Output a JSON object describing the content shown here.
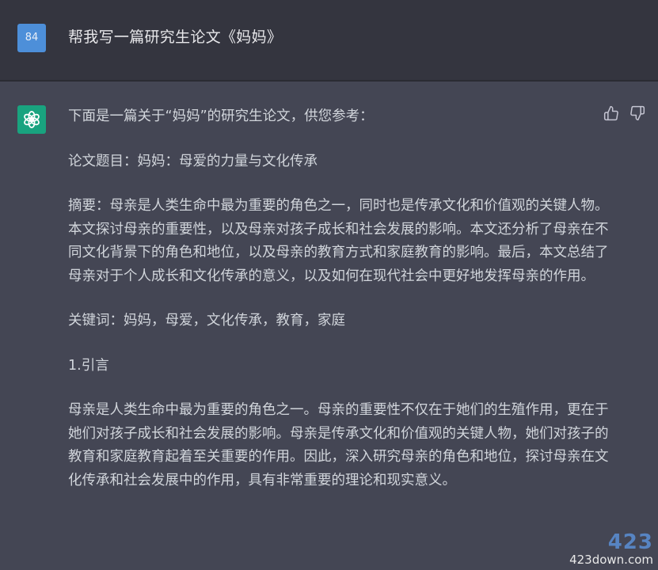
{
  "user": {
    "avatar_label": "84",
    "message": "帮我写一篇研究生论文《妈妈》"
  },
  "assistant": {
    "paragraphs": [
      "下面是一篇关于“妈妈”的研究生论文，供您参考：",
      "论文题目：妈妈：母爱的力量与文化传承",
      "摘要：母亲是人类生命中最为重要的角色之一，同时也是传承文化和价值观的关键人物。本文探讨母亲的重要性，以及母亲对孩子成长和社会发展的影响。本文还分析了母亲在不同文化背景下的角色和地位，以及母亲的教育方式和家庭教育的影响。最后，本文总结了母亲对于个人成长和文化传承的意义，以及如何在现代社会中更好地发挥母亲的作用。",
      "关键词：妈妈，母爱，文化传承，教育，家庭",
      "1.引言",
      "母亲是人类生命中最为重要的角色之一。母亲的重要性不仅在于她们的生殖作用，更在于她们对孩子成长和社会发展的影响。母亲是传承文化和价值观的关键人物，她们对孩子的教育和家庭教育起着至关重要的作用。因此，深入研究母亲的角色和地位，探讨母亲在文化传承和社会发展中的作用，具有非常重要的理论和现实意义。"
    ],
    "icons": {
      "avatar": "openai-logo-icon",
      "like": "thumbs-up-icon",
      "dislike": "thumbs-down-icon"
    }
  },
  "watermark": {
    "logo": "423",
    "text": "423down.com"
  },
  "colors": {
    "user_bg": "#34353f",
    "assistant_bg": "#444654",
    "user_avatar": "#4d8fd9",
    "gpt_avatar": "#19a37f"
  }
}
